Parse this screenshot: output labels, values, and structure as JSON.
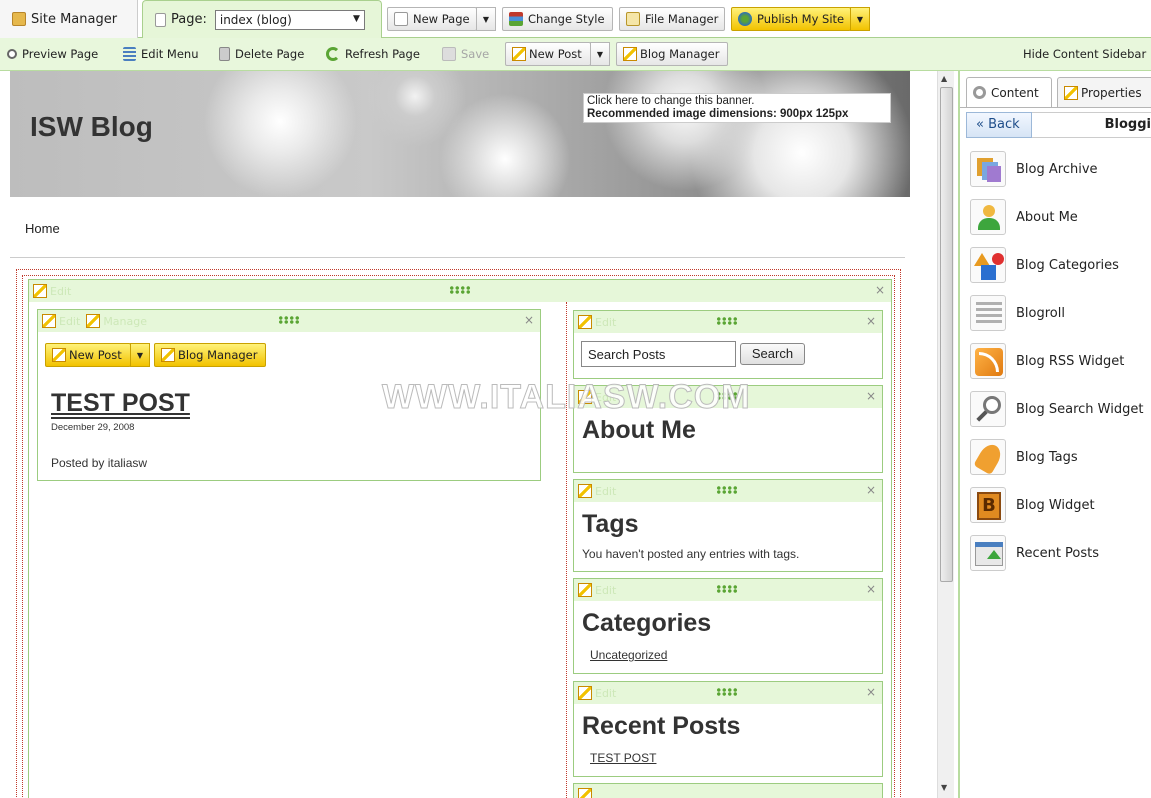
{
  "toolbar1": {
    "site_manager": "Site Manager",
    "page_label": "Page:",
    "page_select": "index (blog)",
    "new_page": "New Page",
    "change_style": "Change Style",
    "file_manager": "File Manager",
    "publish": "Publish My Site"
  },
  "toolbar2": {
    "preview": "Preview Page",
    "edit_menu": "Edit Menu",
    "delete_page": "Delete Page",
    "refresh": "Refresh Page",
    "save": "Save",
    "new_post": "New Post",
    "blog_manager": "Blog Manager",
    "hide_sidebar": "Hide Content Sidebar"
  },
  "banner": {
    "title": "ISW Blog",
    "hint_line1": "Click here to change this banner.",
    "hint_line2": "Recommended image dimensions: 900px 125px"
  },
  "nav": {
    "home": "Home"
  },
  "widget_labels": {
    "edit": "Edit",
    "manage": "Manage",
    "close": "×"
  },
  "blog": {
    "new_post": "New Post",
    "blog_manager": "Blog Manager",
    "post_title": "TEST POST",
    "post_date": "December 29, 2008",
    "posted_by": "Posted by italiasw"
  },
  "right_col": {
    "search_placeholder": "Search Posts",
    "search_button": "Search",
    "about_title": "About Me",
    "tags_title": "Tags",
    "tags_text": "You haven't posted any entries with tags.",
    "categories_title": "Categories",
    "categories_item": "Uncategorized",
    "recent_title": "Recent Posts",
    "recent_item": "TEST POST"
  },
  "watermark": "WWW.ITALIASW.COM",
  "sidebar": {
    "tab_content": "Content",
    "tab_properties": "Properties",
    "back": "« Back",
    "section": "Bloggi",
    "items": [
      {
        "label": "Blog Archive",
        "icon": "blog-archive-icon"
      },
      {
        "label": "About Me",
        "icon": "about-me-icon"
      },
      {
        "label": "Blog Categories",
        "icon": "blog-categories-icon"
      },
      {
        "label": "Blogroll",
        "icon": "blogroll-icon"
      },
      {
        "label": "Blog RSS Widget",
        "icon": "rss-icon"
      },
      {
        "label": "Blog Search Widget",
        "icon": "search-icon"
      },
      {
        "label": "Blog Tags",
        "icon": "tag-icon"
      },
      {
        "label": "Blog Widget",
        "icon": "blog-widget-icon"
      },
      {
        "label": "Recent Posts",
        "icon": "recent-posts-icon"
      }
    ]
  }
}
